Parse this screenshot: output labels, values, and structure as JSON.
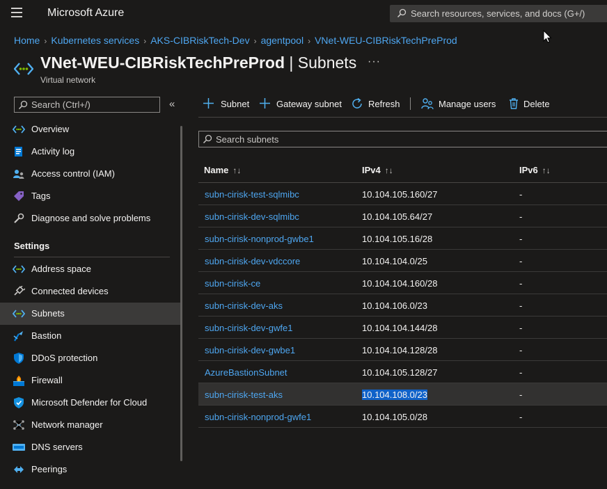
{
  "topbar": {
    "brand": "Microsoft Azure",
    "search_placeholder": "Search resources, services, and docs (G+/)"
  },
  "breadcrumb": [
    "Home",
    "Kubernetes services",
    "AKS-CIBRiskTech-Dev",
    "agentpool",
    "VNet-WEU-CIBRiskTechPreProd"
  ],
  "header": {
    "resource_name": "VNet-WEU-CIBRiskTechPreProd",
    "separator": " | ",
    "blade_name": "Subnets",
    "resource_type": "Virtual network",
    "more": "···"
  },
  "sidebar": {
    "search_placeholder": "Search (Ctrl+/)",
    "collapse": "«",
    "top_items": [
      {
        "label": "Overview",
        "icon": "overview-icon"
      },
      {
        "label": "Activity log",
        "icon": "activity-log-icon"
      },
      {
        "label": "Access control (IAM)",
        "icon": "iam-icon"
      },
      {
        "label": "Tags",
        "icon": "tag-icon"
      },
      {
        "label": "Diagnose and solve problems",
        "icon": "wrench-icon"
      }
    ],
    "section_label": "Settings",
    "settings_items": [
      {
        "label": "Address space",
        "icon": "address-space-icon"
      },
      {
        "label": "Connected devices",
        "icon": "plug-icon"
      },
      {
        "label": "Subnets",
        "icon": "subnets-icon",
        "active": true
      },
      {
        "label": "Bastion",
        "icon": "bastion-icon"
      },
      {
        "label": "DDoS protection",
        "icon": "shield-icon"
      },
      {
        "label": "Firewall",
        "icon": "firewall-icon"
      },
      {
        "label": "Microsoft Defender for Cloud",
        "icon": "defender-icon"
      },
      {
        "label": "Network manager",
        "icon": "network-manager-icon"
      },
      {
        "label": "DNS servers",
        "icon": "dns-icon"
      },
      {
        "label": "Peerings",
        "icon": "peerings-icon"
      }
    ]
  },
  "toolbar": {
    "add_subnet": "Subnet",
    "add_gateway_subnet": "Gateway subnet",
    "refresh": "Refresh",
    "manage_users": "Manage users",
    "delete": "Delete"
  },
  "grid": {
    "search_placeholder": "Search subnets",
    "columns": [
      "Name",
      "IPv4",
      "IPv6"
    ],
    "sort_glyph": "↑↓",
    "rows": [
      {
        "name": "subn-cirisk-test-sqlmibc",
        "ipv4": "10.104.105.160/27",
        "ipv6": "-"
      },
      {
        "name": "subn-cirisk-dev-sqlmibc",
        "ipv4": "10.104.105.64/27",
        "ipv6": "-"
      },
      {
        "name": "subn-cirisk-nonprod-gwbe1",
        "ipv4": "10.104.105.16/28",
        "ipv6": "-"
      },
      {
        "name": "subn-cirisk-dev-vdccore",
        "ipv4": "10.104.104.0/25",
        "ipv6": "-"
      },
      {
        "name": "subn-cirisk-ce",
        "ipv4": "10.104.104.160/28",
        "ipv6": "-"
      },
      {
        "name": "subn-cirisk-dev-aks",
        "ipv4": "10.104.106.0/23",
        "ipv6": "-"
      },
      {
        "name": "subn-cirisk-dev-gwfe1",
        "ipv4": "10.104.104.144/28",
        "ipv6": "-"
      },
      {
        "name": "subn-cirisk-dev-gwbe1",
        "ipv4": "10.104.104.128/28",
        "ipv6": "-"
      },
      {
        "name": "AzureBastionSubnet",
        "ipv4": "10.104.105.128/27",
        "ipv6": "-"
      },
      {
        "name": "subn-cirisk-test-aks",
        "ipv4": "10.104.108.0/23",
        "ipv6": "-",
        "selected": true
      },
      {
        "name": "subn-cirisk-nonprod-gwfe1",
        "ipv4": "10.104.105.0/28",
        "ipv6": "-"
      }
    ]
  },
  "colors": {
    "background": "#1b1a19",
    "link": "#4ea6f0",
    "accent_blue": "#0078d4",
    "selection": "#0f62c9"
  }
}
